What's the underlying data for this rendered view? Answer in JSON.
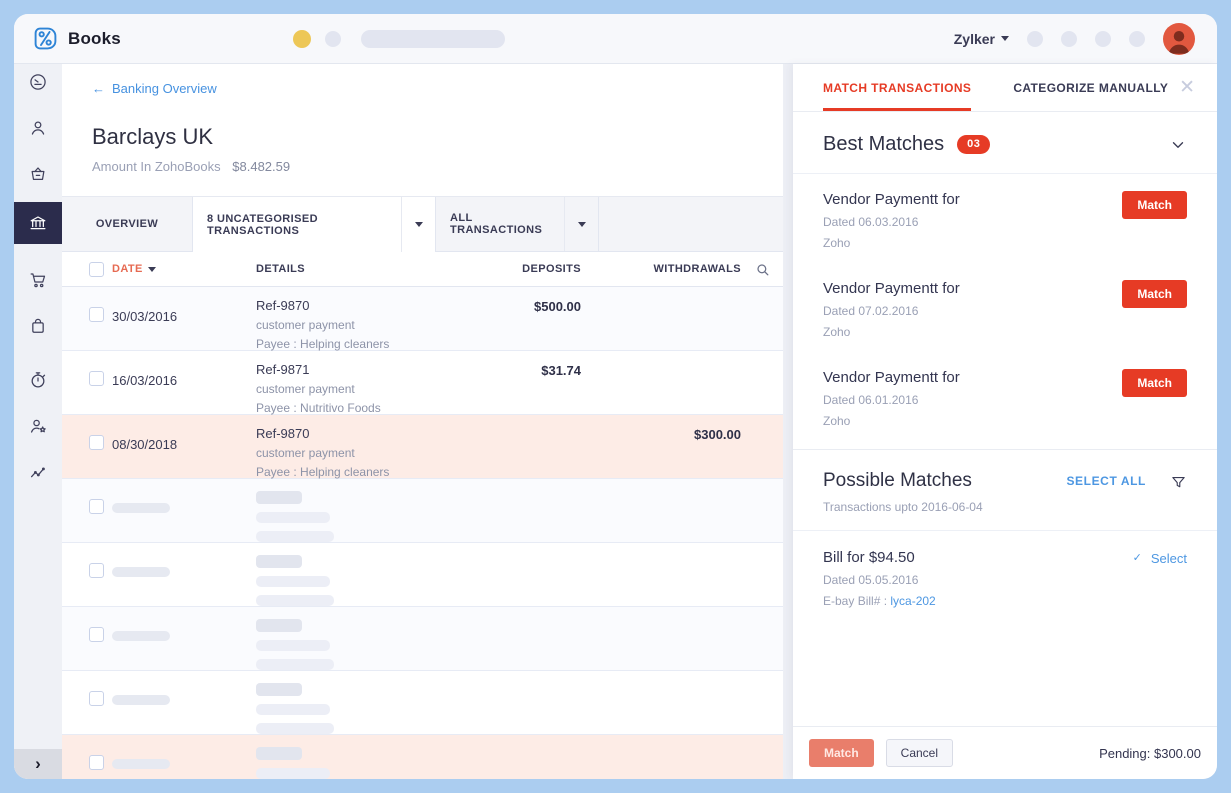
{
  "topbar": {
    "app_name": "Books",
    "org_name": "Zylker"
  },
  "sidebar": {
    "items": [
      {
        "name": "dashboard",
        "active": false,
        "group_break_after": false
      },
      {
        "name": "contacts",
        "active": false,
        "group_break_after": false
      },
      {
        "name": "items",
        "active": false,
        "group_break_after": false
      },
      {
        "name": "banking",
        "active": true,
        "group_break_after": true
      },
      {
        "name": "sales",
        "active": false,
        "group_break_after": false
      },
      {
        "name": "purchases",
        "active": false,
        "group_break_after": true
      },
      {
        "name": "time-tracking",
        "active": false,
        "group_break_after": false
      },
      {
        "name": "accountant",
        "active": false,
        "group_break_after": false
      },
      {
        "name": "reports",
        "active": false,
        "group_break_after": false
      }
    ],
    "expand_glyph": "›"
  },
  "nav": {
    "back_arrow": "←",
    "back_label": "Banking Overview"
  },
  "account": {
    "name": "Barclays UK",
    "amount_label": "Amount In ZohoBooks",
    "amount": "$8.482.59"
  },
  "tabs": [
    {
      "label": "OVERVIEW",
      "caret": false,
      "active": false
    },
    {
      "label": "8 UNCATEGORISED TRANSACTIONS",
      "caret": true,
      "active": true
    },
    {
      "label": "ALL TRANSACTIONS",
      "caret": true,
      "active": false
    }
  ],
  "table": {
    "headers": {
      "date": "DATE",
      "details": "DETAILS",
      "deposits": "DEPOSITS",
      "withdrawals": "WITHDRAWALS"
    },
    "rows": [
      {
        "type": "data",
        "date": "30/03/2016",
        "ref": "Ref-9870",
        "line2": "customer payment",
        "line3": "Payee : Helping cleaners",
        "deposit": "$500.00",
        "withdrawal": "",
        "selected": false,
        "tint": true
      },
      {
        "type": "data",
        "date": "16/03/2016",
        "ref": "Ref-9871",
        "line2": "customer payment",
        "line3": "Payee : Nutritivo Foods",
        "deposit": "$31.74",
        "withdrawal": "",
        "selected": false,
        "tint": false
      },
      {
        "type": "data",
        "date": "08/30/2018",
        "ref": "Ref-9870",
        "line2": "customer payment",
        "line3": "Payee : Helping cleaners",
        "deposit": "",
        "withdrawal": "$300.00",
        "selected": true,
        "tint": false
      },
      {
        "type": "placeholder",
        "amount_col": "withdrawal",
        "selected": false,
        "tint": true
      },
      {
        "type": "placeholder",
        "amount_col": "deposit",
        "selected": false,
        "tint": false
      },
      {
        "type": "placeholder",
        "amount_col": "deposit",
        "selected": false,
        "tint": true
      },
      {
        "type": "placeholder",
        "amount_col": "deposit",
        "selected": false,
        "tint": false
      },
      {
        "type": "placeholder",
        "amount_col": "deposit",
        "selected": true,
        "tint": false
      }
    ]
  },
  "panel": {
    "tabs": [
      {
        "label": "MATCH TRANSACTIONS",
        "active": true
      },
      {
        "label": "CATEGORIZE MANUALLY",
        "active": false
      }
    ],
    "close_glyph": "✕",
    "best_matches": {
      "title": "Best Matches",
      "count": "03",
      "items": [
        {
          "title": "Vendor Paymentt for",
          "dated": "Dated 06.03.2016",
          "vendor": "Zoho",
          "action": "Match"
        },
        {
          "title": "Vendor Paymentt for",
          "dated": "Dated 07.02.2016",
          "vendor": "Zoho",
          "action": "Match"
        },
        {
          "title": "Vendor Paymentt for",
          "dated": "Dated 06.01.2016",
          "vendor": "Zoho",
          "action": "Match"
        }
      ]
    },
    "possible_matches": {
      "title": "Possible Matches",
      "subtitle": "Transactions upto 2016-06-04",
      "select_all": "SELECT ALL",
      "items": [
        {
          "title": "Bill for $94.50",
          "dated": "Dated 05.05.2016",
          "source": "E-bay",
          "bill_label": "Bill# :",
          "bill_number": "lyca-202",
          "check_glyph": "✓",
          "action": "Select"
        }
      ]
    },
    "footer": {
      "match_label": "Match",
      "cancel_label": "Cancel",
      "pending": "Pending: $300.00"
    }
  },
  "colors": {
    "accent_red": "#e63b25",
    "date_header_red": "#e66a52",
    "link_blue": "#4792e0",
    "select_blue": "#4d97e2",
    "frame_blue": "#abcdf0",
    "active_nav_bg": "#2b2c4c",
    "selected_row_pink": "#fdece6"
  }
}
